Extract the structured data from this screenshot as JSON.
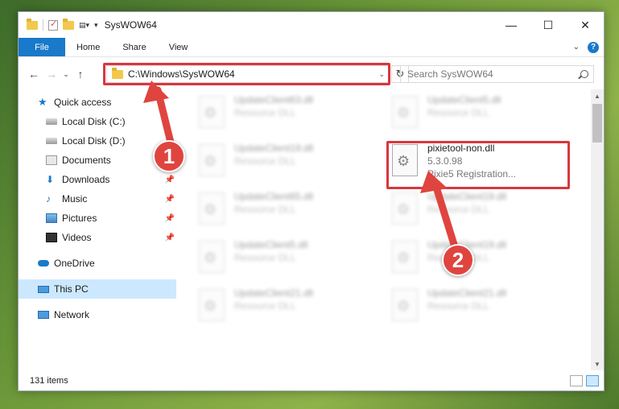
{
  "window": {
    "title": "SysWOW64",
    "controls": {
      "minimize": "—",
      "maximize": "☐",
      "close": "✕"
    }
  },
  "ribbon": {
    "tabs": [
      "File",
      "Home",
      "Share",
      "View"
    ]
  },
  "nav": {
    "address": "C:\\Windows\\SysWOW64",
    "search_placeholder": "Search SysWOW64"
  },
  "sidebar": {
    "items": [
      {
        "label": "Quick access",
        "icon": "star-icon"
      },
      {
        "label": "Local Disk (C:)",
        "icon": "drive-icon"
      },
      {
        "label": "Local Disk (D:)",
        "icon": "drive-icon"
      },
      {
        "label": "Documents",
        "icon": "documents-icon"
      },
      {
        "label": "Downloads",
        "icon": "download-icon"
      },
      {
        "label": "Music",
        "icon": "music-icon"
      },
      {
        "label": "Pictures",
        "icon": "pictures-icon"
      },
      {
        "label": "Videos",
        "icon": "videos-icon"
      },
      {
        "label": "OneDrive",
        "icon": "cloud-icon"
      },
      {
        "label": "This PC",
        "icon": "pc-icon"
      },
      {
        "label": "Network",
        "icon": "network-icon"
      }
    ]
  },
  "files": [
    {
      "name": "UpdateClient63.dll",
      "line2": "Resource DLL",
      "line3": ""
    },
    {
      "name": "UpdateClient5.dll",
      "line2": "Resource DLL",
      "line3": ""
    },
    {
      "name": "UpdateClient19.dll",
      "line2": "Resource DLL",
      "line3": ""
    },
    {
      "name": "pixietool-non.dll",
      "line2": "5.3.0.98",
      "line3": "Pixie5 Registration..."
    },
    {
      "name": "UpdateClient65.dll",
      "line2": "Resource DLL",
      "line3": ""
    },
    {
      "name": "UpdateClient19.dll",
      "line2": "Resource DLL",
      "line3": ""
    },
    {
      "name": "UpdateClient5.dll",
      "line2": "Resource DLL",
      "line3": ""
    },
    {
      "name": "UpdateClient19.dll",
      "line2": "Resource DLL",
      "line3": ""
    },
    {
      "name": "UpdateClient21.dll",
      "line2": "Resource DLL",
      "line3": ""
    },
    {
      "name": "UpdateClient21.dll",
      "line2": "Resource DLL",
      "line3": ""
    }
  ],
  "status": {
    "item_count": "131 items"
  },
  "annotations": {
    "callout_1": "1",
    "callout_2": "2",
    "color": "#d9363e"
  }
}
